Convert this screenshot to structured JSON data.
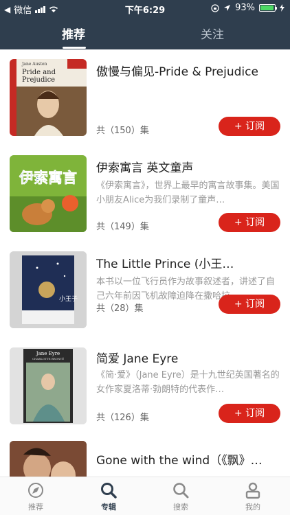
{
  "status_bar": {
    "carrier": "微信",
    "time": "下午6:29",
    "battery": "93%",
    "battery_level": 0.93,
    "icons": [
      "back-arrow-icon",
      "signal-icon",
      "wifi-icon",
      "lock-rotation-icon",
      "location-icon",
      "battery-icon",
      "charging-icon"
    ]
  },
  "header": {
    "tabs": [
      {
        "label": "推荐",
        "active": true
      },
      {
        "label": "关注",
        "active": false
      }
    ]
  },
  "items": [
    {
      "title": "傲慢与偏见-Pride & Prejudice",
      "desc": "",
      "count": "共（150）集",
      "button": "+ 订阅",
      "cover_texts": [
        "Jane Austen",
        "Pride and",
        "Prejudice"
      ]
    },
    {
      "title": "伊索寓言 英文童声",
      "desc": "《伊索寓言》，世界上最早的寓言故事集。美国小朋友Alice为我们录制了童声…",
      "count": "共（149）集",
      "button": "+ 订阅",
      "cover_texts": [
        "伊索寓言"
      ]
    },
    {
      "title": "The Little Prince (小王…",
      "desc": "本书以一位飞行员作为故事叙述者，讲述了自己六年前因飞机故障迫降在撒哈拉…",
      "count": "共（28）集",
      "button": "+ 订阅",
      "cover_texts": [
        "小王子"
      ]
    },
    {
      "title": "简爱 Jane Eyre",
      "desc": "《简·爱》（Jane Eyre）是十九世纪英国著名的女作家夏洛蒂·勃朗特的代表作…",
      "count": "共（126）集",
      "button": "+ 订阅",
      "cover_texts": [
        "Jane Eyre",
        "CHARLOTTE BRONTË"
      ]
    },
    {
      "title": "Gone with the wind（《飘》…",
      "desc": "",
      "count": "",
      "button": "",
      "cover_texts": []
    }
  ],
  "bottom_nav": [
    {
      "label": "推荐",
      "icon": "compass-icon",
      "active": false
    },
    {
      "label": "专辑",
      "icon": "search-icon",
      "active": true
    },
    {
      "label": "搜索",
      "icon": "search-icon",
      "active": false
    },
    {
      "label": "我的",
      "icon": "user-icon",
      "active": false
    }
  ],
  "colors": {
    "header_bg": "#2f3e4e",
    "accent": "#d9241b",
    "active_tab_text": "#ffffff",
    "inactive_tab_text": "#b9c2cc"
  }
}
